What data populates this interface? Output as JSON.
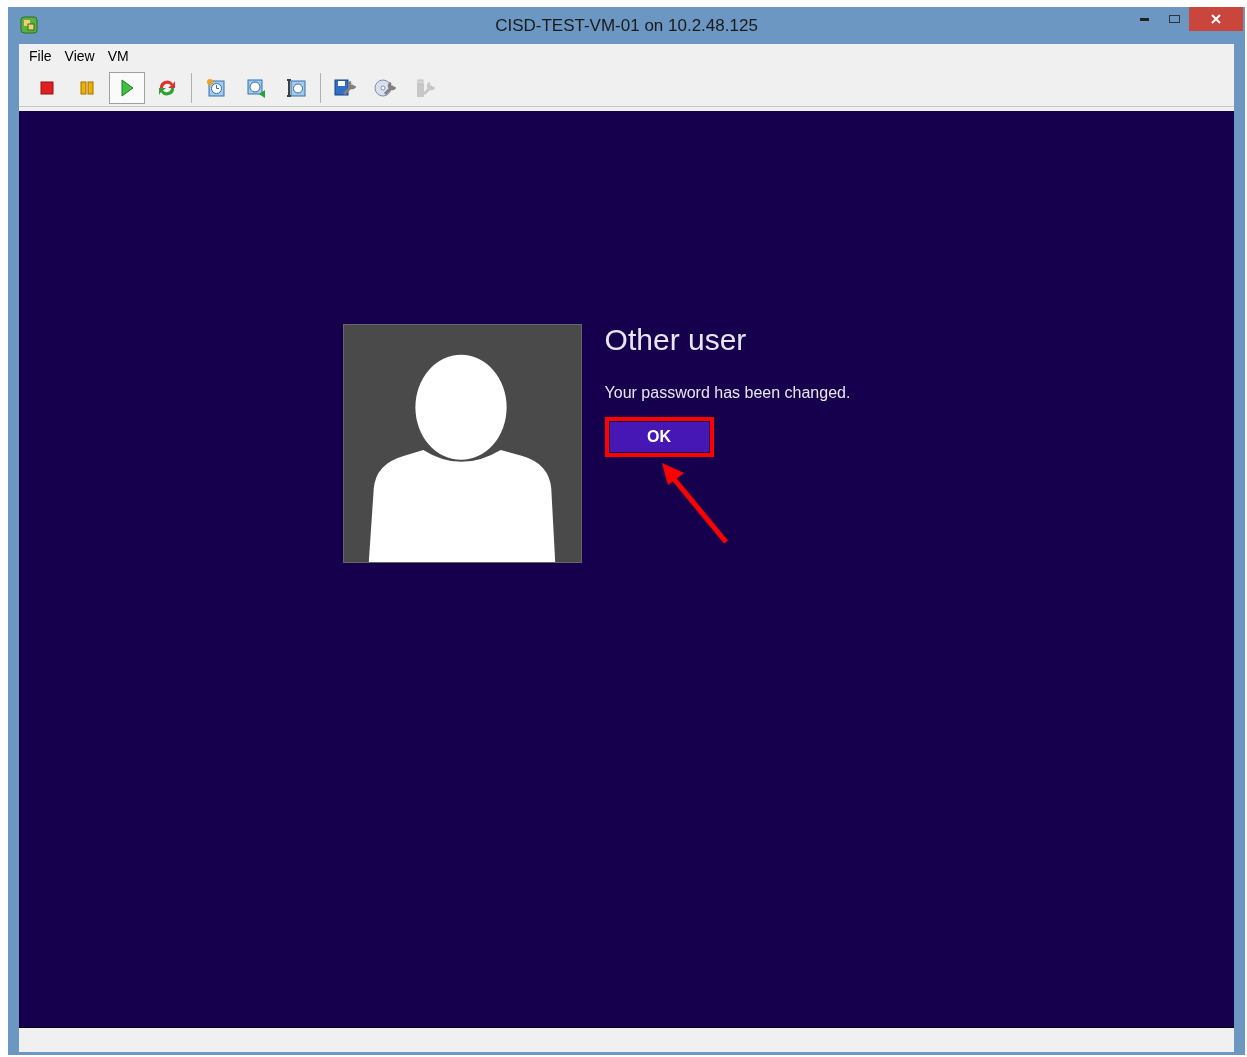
{
  "window": {
    "title": "CISD-TEST-VM-01 on 10.2.48.125"
  },
  "menu": [
    "File",
    "View",
    "VM"
  ],
  "toolbar": [
    {
      "kind": "stop",
      "selected": false,
      "disabled": false
    },
    {
      "kind": "pause",
      "selected": false,
      "disabled": false
    },
    {
      "kind": "play",
      "selected": true,
      "disabled": false
    },
    {
      "kind": "reset",
      "selected": false,
      "disabled": false
    },
    {
      "kind": "separator"
    },
    {
      "kind": "snapshot",
      "selected": false,
      "disabled": false
    },
    {
      "kind": "revert",
      "selected": false,
      "disabled": false
    },
    {
      "kind": "snapshot-manager",
      "selected": false,
      "disabled": false
    },
    {
      "kind": "separator"
    },
    {
      "kind": "settings",
      "selected": false,
      "disabled": false
    },
    {
      "kind": "cd",
      "selected": false,
      "disabled": false
    },
    {
      "kind": "usb",
      "selected": false,
      "disabled": true
    }
  ],
  "login": {
    "user_name": "Other user",
    "message": "Your password has been changed.",
    "button": {
      "label": "OK",
      "annotated": true
    }
  }
}
